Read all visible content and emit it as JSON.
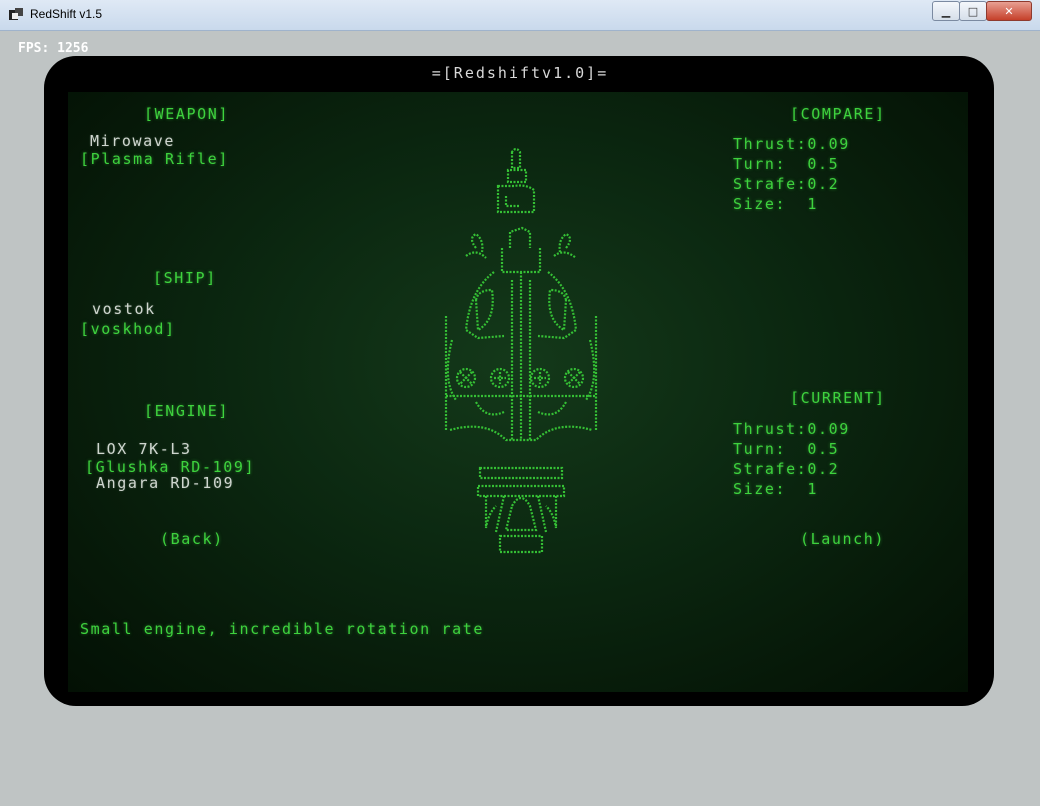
{
  "window": {
    "title": "RedShift v1.5",
    "buttons": {
      "minimize": "▁",
      "maximize": "□",
      "close": "✕"
    }
  },
  "hud": {
    "fps": "FPS: 1256"
  },
  "crt": {
    "title": "=[Redshiftv1.0]="
  },
  "weapon": {
    "header": "[WEAPON]",
    "option": "Mirowave",
    "selected": "[Plasma Rifle]"
  },
  "ship": {
    "header": "[SHIP]",
    "option": "vostok",
    "selected": "[voskhod]"
  },
  "engine": {
    "header": "[ENGINE]",
    "option_prev": "LOX 7K-L3",
    "selected": "[Glushka RD-109]",
    "option_next": "Angara RD-109"
  },
  "compare": {
    "header": "[COMPARE]",
    "thrust": "Thrust:0.09",
    "turn": "Turn:  0.5",
    "strafe": "Strafe:0.2",
    "size": "Size:  1"
  },
  "current": {
    "header": "[CURRENT]",
    "thrust": "Thrust:0.09",
    "turn": "Turn:  0.5",
    "strafe": "Strafe:0.2",
    "size": "Size:  1"
  },
  "actions": {
    "back": "(Back)",
    "launch": "(Launch)"
  },
  "description": "Small engine, incredible rotation rate",
  "colors": {
    "phosphor_green": "#3ed23e",
    "text_white": "#cfd6cf",
    "screen_bg": "#0b2710"
  }
}
